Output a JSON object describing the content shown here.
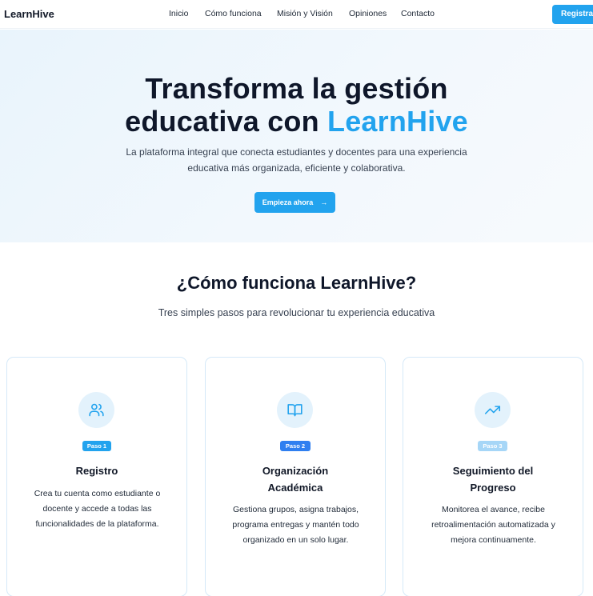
{
  "brand": "LearnHive",
  "nav": {
    "links": [
      "Inicio",
      "Cómo funciona",
      "Misión y Visión",
      "Opiniones",
      "Contacto"
    ],
    "cta": "Registrarse"
  },
  "hero": {
    "title_line1": "Transforma la gestión",
    "title_line2": "educativa con ",
    "title_accent": "LearnHive",
    "subtitle": "La plataforma integral que conecta estudiantes y docentes para una experiencia educativa más organizada, eficiente y colaborativa.",
    "button_label": "Empieza ahora",
    "button_arrow": "→"
  },
  "how": {
    "title": "¿Cómo funciona LearnHive?",
    "subtitle": "Tres simples pasos para revolucionar tu experiencia educativa",
    "steps": [
      {
        "badge": "Paso 1",
        "badge_color": "#22a3ee",
        "icon": "users-icon",
        "title": "Registro",
        "description": "Crea tu cuenta como estudiante o docente y accede a todas las funcionalidades de la plataforma."
      },
      {
        "badge": "Paso 2",
        "badge_color": "#2f7ff0",
        "icon": "book-open-icon",
        "title": "Organización Académica",
        "description": "Gestiona grupos, asigna trabajos, programa entregas y mantén todo organizado en un solo lugar."
      },
      {
        "badge": "Paso 3",
        "badge_color": "#a6d6f7",
        "icon": "trending-up-icon",
        "title": "Seguimiento del Progreso",
        "description": "Monitorea el avance, recibe retroalimentación automatizada y mejora continuamente."
      }
    ]
  },
  "colors": {
    "accent": "#22a3ee",
    "heading": "#0f172a",
    "card_border": "#d5e9f8",
    "icon_bg": "#e3f2fc"
  }
}
